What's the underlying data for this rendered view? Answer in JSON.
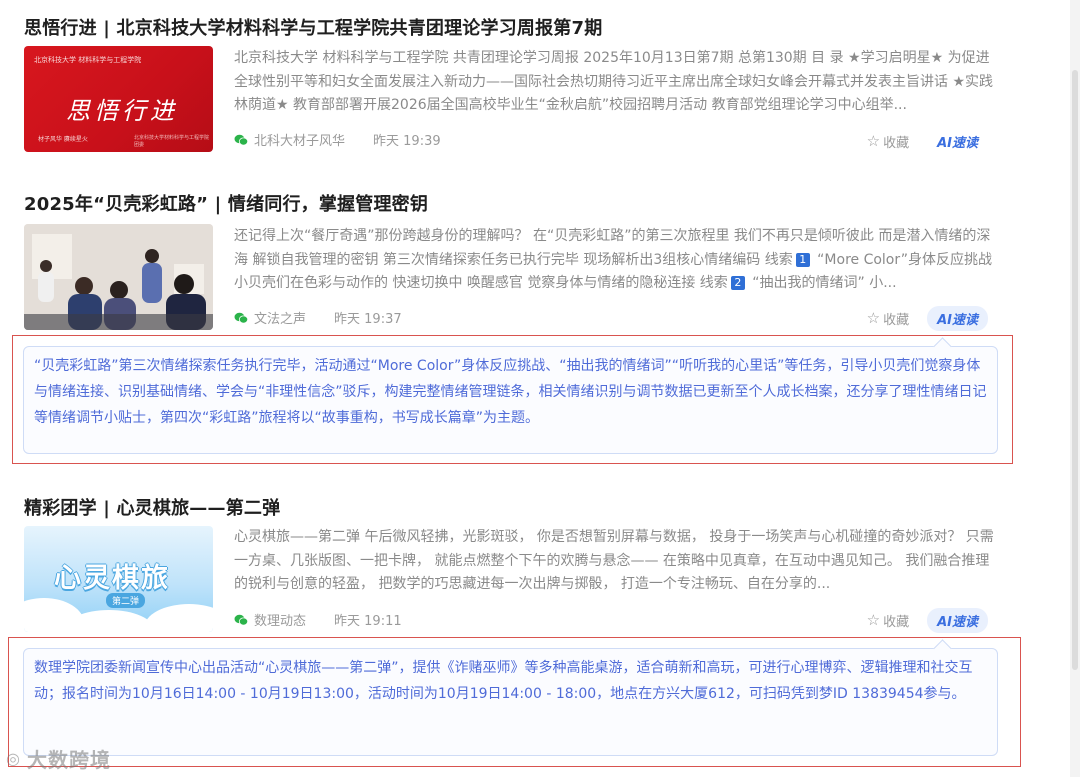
{
  "articles": [
    {
      "title": "思悟行进 | 北京科技大学材料科学与工程学院共青团理论学习周报第7期",
      "summary": "北京科技大学 材料科学与工程学院 共青团理论学习周报 2025年10月13日第7期 总第130期 目 录 ★学习启明星★ 为促进全球性别平等和妇女全面发展注入新动力——国际社会热切期待习近平主席出席全球妇女峰会开幕式并发表主旨讲话 ★实践林荫道★ 教育部部署开展2026届全国高校毕业生“金秋启航”校园招聘月活动 教育部党组理论学习中心组举...",
      "source": "北科大材子风华",
      "time": "昨天 19:39",
      "fav_label": "收藏",
      "ai_label": "AI速读",
      "thumb": {
        "top_left": "北京科技大学 材料科学与工程学院",
        "big": "思悟行进",
        "bottom_left": "材子风华  赓续星火",
        "bottom_right": "北京科技大学材料科学与工程学院团委"
      }
    },
    {
      "title": "2025年“贝壳彩虹路” | 情绪同行，掌握管理密钥",
      "summary_parts": [
        "还记得上次“餐厅奇遇”那份跨越身份的理解吗？ 在“贝壳彩虹路”的第三次旅程里 我们不再只是倾听彼此 而是潜入情绪的深海 解锁自我管理的密钥 第三次情绪探索任务已执行完毕 现场解析出3组核心情绪编码 线索",
        "1",
        " “More Color”身体反应挑战 小贝壳们在色彩与动作的 快速切换中 唤醒感官 觉察身体与情绪的隐秘连接 线索",
        "2",
        " “抽出我的情绪词” 小..."
      ],
      "source": "文法之声",
      "time": "昨天 19:37",
      "fav_label": "收藏",
      "ai_label": "AI速读",
      "ai_summary": "“贝壳彩虹路”第三次情绪探索任务执行完毕，活动通过“More Color”身体反应挑战、“抽出我的情绪词”“听听我的心里话”等任务，引导小贝壳们觉察身体与情绪连接、识别基础情绪、学会与“非理性信念”驳斥，构建完整情绪管理链条，相关情绪识别与调节数据已更新至个人成长档案，还分享了理性情绪日记等情绪调节小贴士，第四次“彩虹路”旅程将以“故事重构，书写成长篇章”为主题。"
    },
    {
      "title": "精彩团学 | 心灵棋旅——第二弹",
      "summary": "心灵棋旅——第二弹 午后微风轻拂，光影斑驳， 你是否想暂别屏幕与数据， 投身于一场笑声与心机碰撞的奇妙派对？ 只需一方桌、几张版图、一把卡牌， 就能点燃整个下午的欢腾与悬念—— 在策略中见真章，在互动中遇见知己。 我们融合推理的锐利与创意的轻盈， 把数学的巧思藏进每一次出牌与掷骰， 打造一个专注畅玩、自在分享的...",
      "source": "数理动态",
      "time": "昨天 19:11",
      "fav_label": "收藏",
      "ai_label": "AI速读",
      "thumb": {
        "big": "心灵棋旅",
        "sub": "第二弹"
      },
      "ai_summary": "数理学院团委新闻宣传中心出品活动“心灵棋旅——第二弹”，提供《诈赌巫师》等多种高能桌游，适合萌新和高玩，可进行心理博弈、逻辑推理和社交互动；报名时间为10月16日14:00 - 10月19日13:00，活动时间为10月19日14:00 - 18:00，地点在方兴大厦612，可扫码凭到梦ID 13839454参与。"
    }
  ],
  "watermark": "大数跨境",
  "colors": {
    "accent": "#3b6fe0",
    "highlight_box": "#d9534f",
    "ai_text": "#4f6bd8",
    "wechat_green": "#2bb34a"
  }
}
